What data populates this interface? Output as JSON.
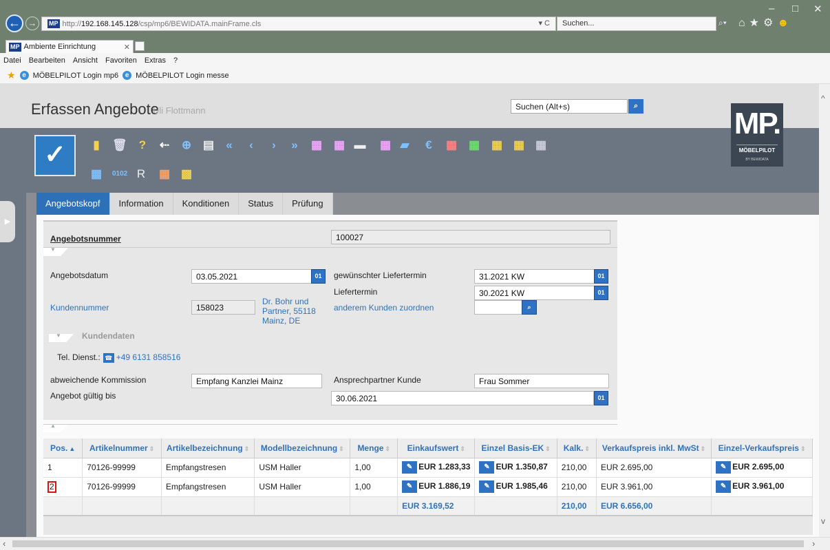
{
  "browser": {
    "url_host": "192.168.145.128",
    "url_prefix": "http://",
    "url_path": "/csp/mp6/BEWIDATA.mainFrame.cls",
    "refresh": "▾ C",
    "search_placeholder": "Suchen...",
    "tab_title": "Ambiente Einrichtung",
    "favicon": "MP",
    "menu": [
      "Datei",
      "Bearbeiten",
      "Ansicht",
      "Favoriten",
      "Extras",
      "?"
    ],
    "favorites": [
      "MÖBELPILOT Login mp6",
      "MÖBELPILOT Login messe"
    ],
    "window_controls": [
      "–",
      "□",
      "✕"
    ]
  },
  "app": {
    "title": "Erfassen Angebote",
    "user": "Uli Flottmann",
    "search_placeholder": "Suchen (Alt+s)",
    "logo_big": "MP.",
    "logo_small": "MÖBELPILOT",
    "logo_tiny": "BY BEWIDATA",
    "tabs": [
      "Angebotskopf",
      "Information",
      "Konditionen",
      "Status",
      "Prüfung"
    ],
    "toolbar_r": "R"
  },
  "form": {
    "angebotsnummer_label": "Angebotsnummer",
    "angebotsnummer": "100027",
    "angebotsdatum_label": "Angebotsdatum",
    "angebotsdatum": "03.05.2021",
    "wunsch_liefertermin_label": "gewünschter Liefertermin",
    "wunsch_liefertermin": "31.2021 KW",
    "liefertermin_label": "Liefertermin",
    "liefertermin": "30.2021 KW",
    "kundennummer_label": "Kundennummer",
    "kundennummer": "158023",
    "kunde_line1": "Dr. Bohr und",
    "kunde_line2": "Partner, 55118",
    "kunde_line3": "Mainz, DE",
    "anderer_kunde_label": "anderem Kunden zuordnen",
    "kundendaten_label": "Kundendaten",
    "tel_label": "Tel. Dienst.:",
    "tel_value": "+49 6131 858516",
    "kommission_label": "abweichende Kommission",
    "kommission": "Empfang Kanzlei Mainz",
    "ansprechpartner_label": "Ansprechpartner Kunde",
    "ansprechpartner": "Frau Sommer",
    "gueltig_label": "Angebot gültig bis",
    "gueltig": "30.06.2021"
  },
  "table": {
    "headers": [
      "Pos.",
      "Artikelnummer",
      "Artikelbezeichnung",
      "Modellbezeichnung",
      "Menge",
      "Einkaufswert",
      "Einzel Basis-EK",
      "Kalk.",
      "Verkaufspreis inkl. MwSt",
      "Einzel-Verkaufspreis"
    ],
    "rows": [
      {
        "pos": "1",
        "artikelnummer": "70126-99999",
        "bezeichnung": "Empfangstresen",
        "modell": "USM Haller",
        "menge": "1,00",
        "einkaufswert": "EUR 1.283,33",
        "basis_ek": "EUR 1.350,87",
        "kalk": "210,00",
        "vk_inkl": "EUR 2.695,00",
        "einzel_vk": "EUR 2.695,00"
      },
      {
        "pos": "2",
        "artikelnummer": "70126-99999",
        "bezeichnung": "Empfangstresen",
        "modell": "USM Haller",
        "menge": "1,00",
        "einkaufswert": "EUR 1.886,19",
        "basis_ek": "EUR 1.985,46",
        "kalk": "210,00",
        "vk_inkl": "EUR 3.961,00",
        "einzel_vk": "EUR 3.961,00"
      }
    ],
    "sum": {
      "einkaufswert": "EUR 3.169,52",
      "kalk": "210,00",
      "vk_inkl": "EUR 6.656,00"
    }
  }
}
